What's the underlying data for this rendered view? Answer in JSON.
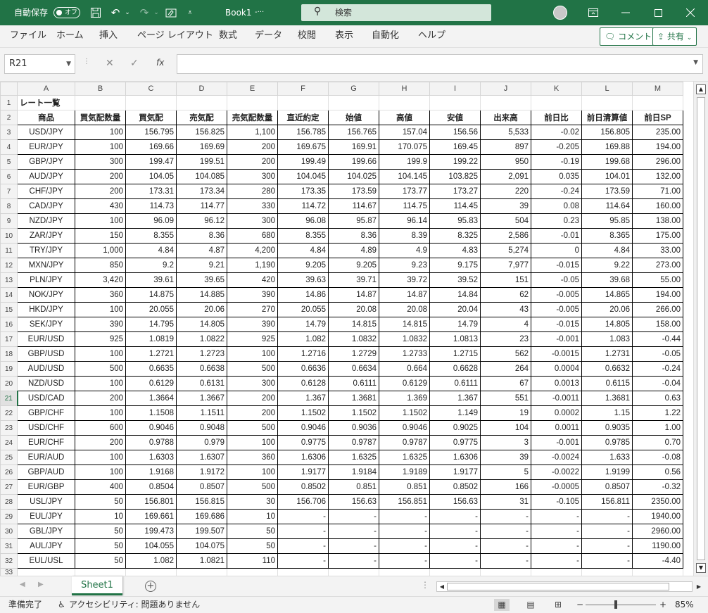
{
  "titlebar": {
    "autosave_label": "自動保存",
    "autosave_state": "オフ",
    "filename": "Book1",
    "filename_suffix": "-···",
    "search_placeholder": "検索"
  },
  "ribbon": {
    "tabs": [
      "ファイル",
      "ホーム",
      "挿入",
      "ページ レイアウト",
      "数式",
      "データ",
      "校閲",
      "表示",
      "自動化",
      "ヘルプ"
    ],
    "comment_label": "コメント",
    "share_label": "共有"
  },
  "formula_bar": {
    "name_box": "R21",
    "fx_label": "fx",
    "formula": ""
  },
  "columns": [
    "A",
    "B",
    "C",
    "D",
    "E",
    "F",
    "G",
    "H",
    "I",
    "J",
    "K",
    "L",
    "M"
  ],
  "title_cell": "レート一覧",
  "header": [
    "商品",
    "買気配数量",
    "買気配",
    "売気配",
    "売気配数量",
    "直近約定",
    "始値",
    "高値",
    "安値",
    "出来高",
    "前日比",
    "前日清算値",
    "前日SP"
  ],
  "rows": [
    [
      "USD/JPY",
      "100",
      "156.795",
      "156.825",
      "1,100",
      "156.785",
      "156.765",
      "157.04",
      "156.56",
      "5,533",
      "-0.02",
      "156.805",
      "235.00"
    ],
    [
      "EUR/JPY",
      "100",
      "169.66",
      "169.69",
      "200",
      "169.675",
      "169.91",
      "170.075",
      "169.45",
      "897",
      "-0.205",
      "169.88",
      "194.00"
    ],
    [
      "GBP/JPY",
      "300",
      "199.47",
      "199.51",
      "200",
      "199.49",
      "199.66",
      "199.9",
      "199.22",
      "950",
      "-0.19",
      "199.68",
      "296.00"
    ],
    [
      "AUD/JPY",
      "200",
      "104.05",
      "104.085",
      "300",
      "104.045",
      "104.025",
      "104.145",
      "103.825",
      "2,091",
      "0.035",
      "104.01",
      "132.00"
    ],
    [
      "CHF/JPY",
      "200",
      "173.31",
      "173.34",
      "280",
      "173.35",
      "173.59",
      "173.77",
      "173.27",
      "220",
      "-0.24",
      "173.59",
      "71.00"
    ],
    [
      "CAD/JPY",
      "430",
      "114.73",
      "114.77",
      "330",
      "114.72",
      "114.67",
      "114.75",
      "114.45",
      "39",
      "0.08",
      "114.64",
      "160.00"
    ],
    [
      "NZD/JPY",
      "100",
      "96.09",
      "96.12",
      "300",
      "96.08",
      "95.87",
      "96.14",
      "95.83",
      "504",
      "0.23",
      "95.85",
      "138.00"
    ],
    [
      "ZAR/JPY",
      "150",
      "8.355",
      "8.36",
      "680",
      "8.355",
      "8.36",
      "8.39",
      "8.325",
      "2,586",
      "-0.01",
      "8.365",
      "175.00"
    ],
    [
      "TRY/JPY",
      "1,000",
      "4.84",
      "4.87",
      "4,200",
      "4.84",
      "4.89",
      "4.9",
      "4.83",
      "5,274",
      "0",
      "4.84",
      "33.00"
    ],
    [
      "MXN/JPY",
      "850",
      "9.2",
      "9.21",
      "1,190",
      "9.205",
      "9.205",
      "9.23",
      "9.175",
      "7,977",
      "-0.015",
      "9.22",
      "273.00"
    ],
    [
      "PLN/JPY",
      "3,420",
      "39.61",
      "39.65",
      "420",
      "39.63",
      "39.71",
      "39.72",
      "39.52",
      "151",
      "-0.05",
      "39.68",
      "55.00"
    ],
    [
      "NOK/JPY",
      "360",
      "14.875",
      "14.885",
      "390",
      "14.86",
      "14.87",
      "14.87",
      "14.84",
      "62",
      "-0.005",
      "14.865",
      "194.00"
    ],
    [
      "HKD/JPY",
      "100",
      "20.055",
      "20.06",
      "270",
      "20.055",
      "20.08",
      "20.08",
      "20.04",
      "43",
      "-0.005",
      "20.06",
      "266.00"
    ],
    [
      "SEK/JPY",
      "390",
      "14.795",
      "14.805",
      "390",
      "14.79",
      "14.815",
      "14.815",
      "14.79",
      "4",
      "-0.015",
      "14.805",
      "158.00"
    ],
    [
      "EUR/USD",
      "925",
      "1.0819",
      "1.0822",
      "925",
      "1.082",
      "1.0832",
      "1.0832",
      "1.0813",
      "23",
      "-0.001",
      "1.083",
      "-0.44"
    ],
    [
      "GBP/USD",
      "100",
      "1.2721",
      "1.2723",
      "100",
      "1.2716",
      "1.2729",
      "1.2733",
      "1.2715",
      "562",
      "-0.0015",
      "1.2731",
      "-0.05"
    ],
    [
      "AUD/USD",
      "500",
      "0.6635",
      "0.6638",
      "500",
      "0.6636",
      "0.6634",
      "0.664",
      "0.6628",
      "264",
      "0.0004",
      "0.6632",
      "-0.24"
    ],
    [
      "NZD/USD",
      "100",
      "0.6129",
      "0.6131",
      "300",
      "0.6128",
      "0.6111",
      "0.6129",
      "0.6111",
      "67",
      "0.0013",
      "0.6115",
      "-0.04"
    ],
    [
      "USD/CAD",
      "200",
      "1.3664",
      "1.3667",
      "200",
      "1.367",
      "1.3681",
      "1.369",
      "1.367",
      "551",
      "-0.0011",
      "1.3681",
      "0.63"
    ],
    [
      "GBP/CHF",
      "100",
      "1.1508",
      "1.1511",
      "200",
      "1.1502",
      "1.1502",
      "1.1502",
      "1.149",
      "19",
      "0.0002",
      "1.15",
      "1.22"
    ],
    [
      "USD/CHF",
      "600",
      "0.9046",
      "0.9048",
      "500",
      "0.9046",
      "0.9036",
      "0.9046",
      "0.9025",
      "104",
      "0.0011",
      "0.9035",
      "1.00"
    ],
    [
      "EUR/CHF",
      "200",
      "0.9788",
      "0.979",
      "100",
      "0.9775",
      "0.9787",
      "0.9787",
      "0.9775",
      "3",
      "-0.001",
      "0.9785",
      "0.70"
    ],
    [
      "EUR/AUD",
      "100",
      "1.6303",
      "1.6307",
      "360",
      "1.6306",
      "1.6325",
      "1.6325",
      "1.6306",
      "39",
      "-0.0024",
      "1.633",
      "-0.08"
    ],
    [
      "GBP/AUD",
      "100",
      "1.9168",
      "1.9172",
      "100",
      "1.9177",
      "1.9184",
      "1.9189",
      "1.9177",
      "5",
      "-0.0022",
      "1.9199",
      "0.56"
    ],
    [
      "EUR/GBP",
      "400",
      "0.8504",
      "0.8507",
      "500",
      "0.8502",
      "0.851",
      "0.851",
      "0.8502",
      "166",
      "-0.0005",
      "0.8507",
      "-0.32"
    ],
    [
      "USL/JPY",
      "50",
      "156.801",
      "156.815",
      "30",
      "156.706",
      "156.63",
      "156.851",
      "156.63",
      "31",
      "-0.105",
      "156.811",
      "2350.00"
    ],
    [
      "EUL/JPY",
      "10",
      "169.661",
      "169.686",
      "10",
      "-",
      "-",
      "-",
      "-",
      "-",
      "-",
      "-",
      "1940.00"
    ],
    [
      "GBL/JPY",
      "50",
      "199.473",
      "199.507",
      "50",
      "-",
      "-",
      "-",
      "-",
      "-",
      "-",
      "-",
      "2960.00"
    ],
    [
      "AUL/JPY",
      "50",
      "104.055",
      "104.075",
      "50",
      "-",
      "-",
      "-",
      "-",
      "-",
      "-",
      "-",
      "1190.00"
    ],
    [
      "EUL/USL",
      "50",
      "1.082",
      "1.0821",
      "110",
      "-",
      "-",
      "-",
      "-",
      "-",
      "-",
      "-",
      "-4.40"
    ]
  ],
  "selected_row": 21,
  "partial_row": "33",
  "sheet_tab": "Sheet1",
  "status": {
    "ready": "準備完了",
    "accessibility": "アクセシビリティ: 問題ありません",
    "zoom": "85%"
  },
  "colors": {
    "excel_green": "#217346",
    "chrome_gray": "#f3f3f3"
  },
  "icons": [
    "save-icon",
    "undo-icon",
    "redo-icon",
    "customize-icon",
    "search-icon",
    "avatar-icon",
    "ribbon-display-icon",
    "minimize-icon",
    "maximize-icon",
    "close-icon",
    "comment-icon",
    "share-icon",
    "cancel-icon",
    "enter-icon",
    "fx-icon",
    "add-sheet-icon",
    "normal-view-icon",
    "page-layout-icon",
    "page-break-icon"
  ]
}
